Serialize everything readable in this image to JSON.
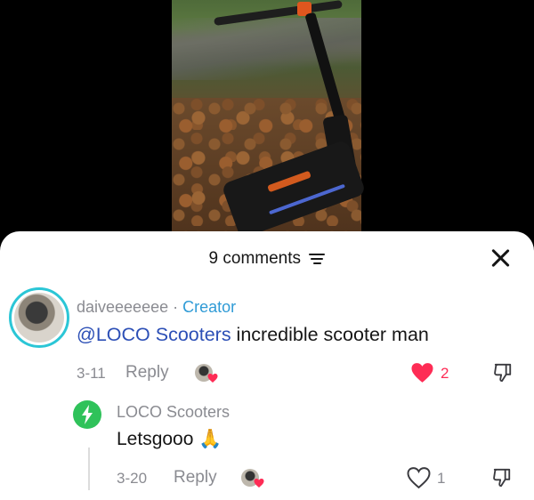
{
  "header": {
    "comments_count": "9 comments"
  },
  "comments": [
    {
      "username": "daiveeeeeee",
      "separator": " · ",
      "badge": "Creator",
      "mention": "@LOCO Scooters",
      "text": " incredible scooter man",
      "date": "3-11",
      "reply_label": "Reply",
      "likes": "2",
      "liked": true,
      "avatar_ring_color": "#2bc6d6"
    },
    {
      "username": "LOCO Scooters",
      "text": "Letsgooo 🙏",
      "date": "3-20",
      "reply_label": "Reply",
      "likes": "1",
      "liked": false,
      "avatar_color": "#2fc25a"
    }
  ],
  "colors": {
    "like_active": "#fe2c55",
    "muted_text": "#8a8b91",
    "mention": "#2c4fb6",
    "creator_badge": "#2f9bd6"
  },
  "icons": [
    "filter-icon",
    "close-icon",
    "heart-icon",
    "dislike-icon",
    "loco-logo-icon"
  ]
}
